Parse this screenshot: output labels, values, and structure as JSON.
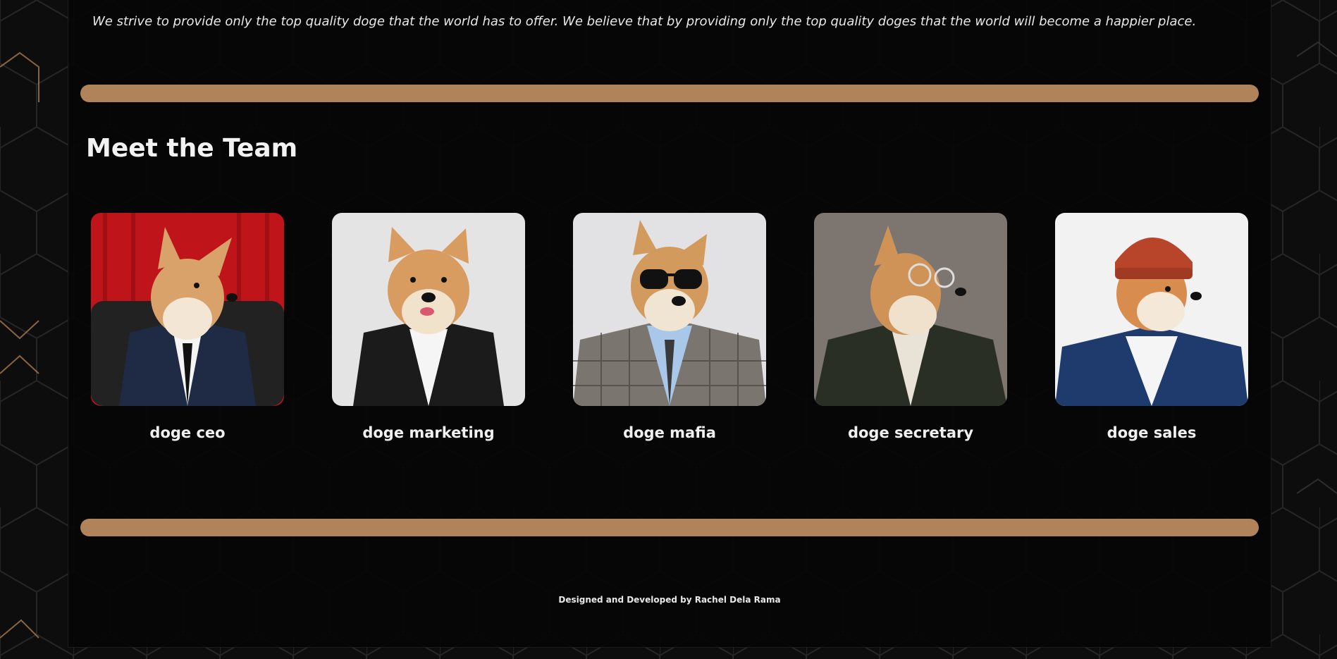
{
  "mission": {
    "text": "We strive to provide only the top quality doge that the world has to offer. We believe that by providing only the top quality doges that the world will become a happier place."
  },
  "team": {
    "heading": "Meet the Team",
    "members": [
      {
        "name": "doge ceo",
        "backdrop": "#c0141b",
        "outfit": "navy-suit"
      },
      {
        "name": "doge marketing",
        "backdrop": "#e4e4e4",
        "outfit": "leather-jacket"
      },
      {
        "name": "doge mafia",
        "backdrop": "#e2e2e4",
        "outfit": "plaid-suit-sunglasses"
      },
      {
        "name": "doge secretary",
        "backdrop": "#7d7570",
        "outfit": "green-jacket-glasses"
      },
      {
        "name": "doge sales",
        "backdrop": "#f2f2f2",
        "outfit": "blue-cardigan-beanie"
      }
    ]
  },
  "footer": {
    "credit": "Designed and Developed by Rachel Dela Rama"
  },
  "colors": {
    "accent": "#b0835a",
    "background": "#0b0b0b",
    "text": "#f0f0f0"
  }
}
